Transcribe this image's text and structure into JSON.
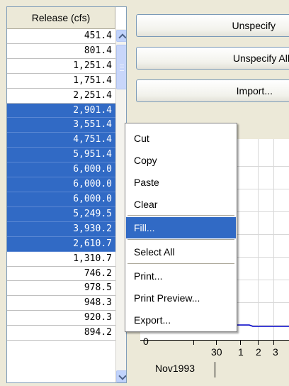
{
  "table": {
    "column_header": "Release (cfs)",
    "rows": [
      {
        "value": "451.4",
        "selected": false
      },
      {
        "value": "801.4",
        "selected": false
      },
      {
        "value": "1,251.4",
        "selected": false
      },
      {
        "value": "1,751.4",
        "selected": false
      },
      {
        "value": "2,251.4",
        "selected": false
      },
      {
        "value": "2,901.4",
        "selected": true
      },
      {
        "value": "3,551.4",
        "selected": true
      },
      {
        "value": "4,751.4",
        "selected": true
      },
      {
        "value": "5,951.4",
        "selected": true
      },
      {
        "value": "6,000.0",
        "selected": true
      },
      {
        "value": "6,000.0",
        "selected": true
      },
      {
        "value": "6,000.0",
        "selected": true
      },
      {
        "value": "5,249.5",
        "selected": true
      },
      {
        "value": "3,930.2",
        "selected": true
      },
      {
        "value": "2,610.7",
        "selected": true
      },
      {
        "value": "1,310.7",
        "selected": false
      },
      {
        "value": "746.2",
        "selected": false
      },
      {
        "value": "978.5",
        "selected": false
      },
      {
        "value": "948.3",
        "selected": false
      },
      {
        "value": "920.3",
        "selected": false
      },
      {
        "value": "894.2",
        "selected": false
      }
    ]
  },
  "buttons": {
    "unspecify": "Unspecify",
    "unspecify_all": "Unspecify All",
    "import": "Import..."
  },
  "context_menu": {
    "items": [
      "Cut",
      "Copy",
      "Paste",
      "Clear",
      "Fill...",
      "Select All",
      "Print...",
      "Print Preview...",
      "Export..."
    ],
    "highlighted": "Fill..."
  },
  "plot": {
    "y_tick": "0",
    "x_ticks": [
      "30",
      "1",
      "2",
      "3"
    ],
    "date_label": "Nov1993",
    "line_color": "#0000cc"
  }
}
